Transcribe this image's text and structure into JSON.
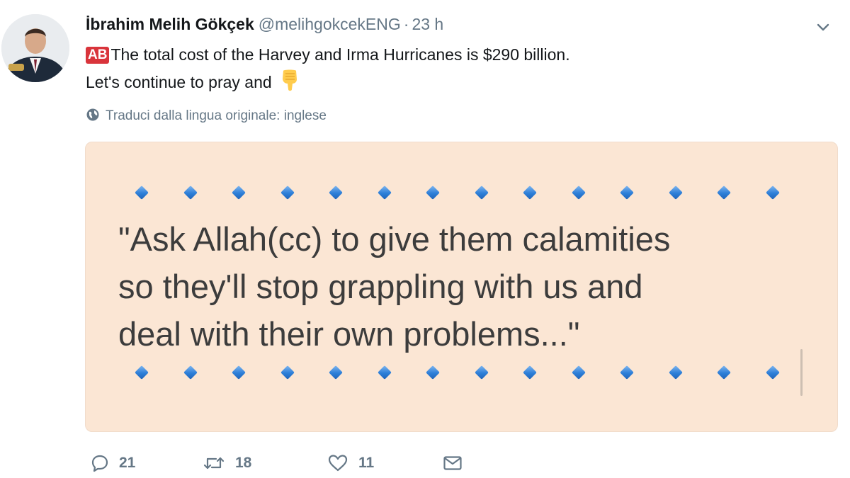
{
  "tweet": {
    "author": {
      "name": "İbrahim Melih Gökçek",
      "handle": "@melihgokcekENG",
      "separator": "·",
      "time": "23 h"
    },
    "text": {
      "badge": "AB",
      "line1": "The total cost of the Harvey and Irma Hurricanes is $290 billion.",
      "line2": "Let's continue to pray and",
      "emoji": "hand-pointing-down-icon"
    },
    "translate_label": "Traduci dalla lingua originale: inglese",
    "media": {
      "quote_lines": [
        "\"Ask Allah(cc) to give them calamities",
        "so they'll stop grappling with us and",
        "deal with their own problems...\""
      ],
      "diamond_color": "#2d7fd8",
      "background_color": "#fbe6d4"
    },
    "actions": {
      "reply_count": "21",
      "retweet_count": "18",
      "like_count": "11"
    },
    "colors": {
      "name": "#14171a",
      "meta": "#657786",
      "badge": "#d9343b"
    }
  }
}
